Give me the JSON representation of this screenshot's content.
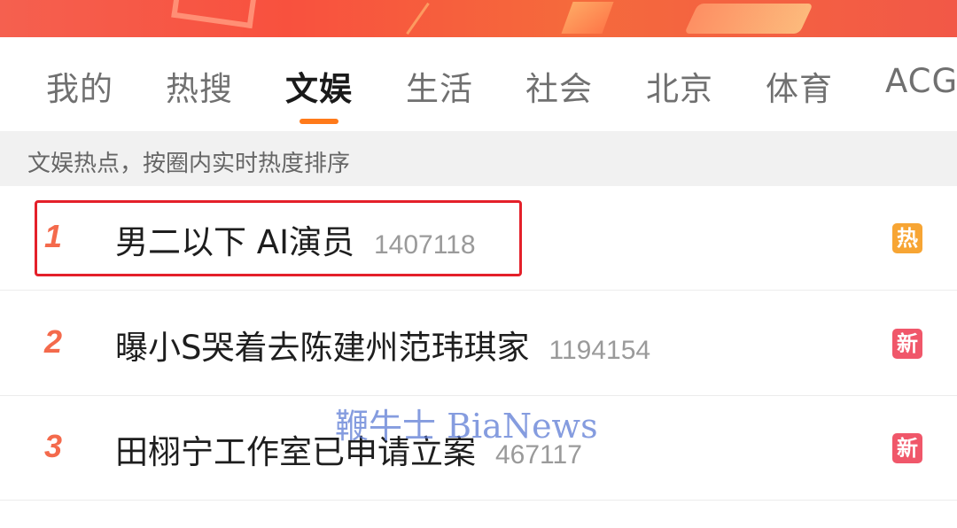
{
  "colors": {
    "accent": "#ff7a1a",
    "rank": "#f46a4c",
    "hot_badge": "#f7a534",
    "new_badge": "#f0576a",
    "highlight": "#e4202a"
  },
  "tabs": [
    {
      "label": "我的"
    },
    {
      "label": "热搜"
    },
    {
      "label": "文娱",
      "active": true
    },
    {
      "label": "生活"
    },
    {
      "label": "社会"
    },
    {
      "label": "北京"
    },
    {
      "label": "体育"
    },
    {
      "label": "ACG"
    }
  ],
  "hint": "文娱热点，按圈内实时热度排序",
  "list": [
    {
      "rank": "1",
      "title": "男二以下 AI演员",
      "count": "1407118",
      "badge": "热",
      "badge_type": "hot"
    },
    {
      "rank": "2",
      "title": "曝小S哭着去陈建州范玮琪家",
      "count": "1194154",
      "badge": "新",
      "badge_type": "new"
    },
    {
      "rank": "3",
      "title": "田栩宁工作室已申请立案",
      "count": "467117",
      "badge": "新",
      "badge_type": "new"
    }
  ],
  "watermark": "鞭牛士 BiaNews"
}
